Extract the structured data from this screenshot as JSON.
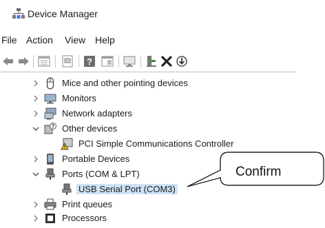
{
  "window": {
    "title": "Device Manager"
  },
  "menu": [
    "File",
    "Action",
    "View",
    "Help"
  ],
  "toolbar": {
    "buttons": [
      "back-icon",
      "forward-icon",
      "properties-list-icon",
      "properties-icon",
      "help-icon",
      "action-view-icon",
      "monitor-icon",
      "update-driver-icon",
      "uninstall-icon",
      "scan-hardware-icon"
    ]
  },
  "tree": {
    "items": [
      {
        "label": "Mice and other pointing devices",
        "state": "collapsed",
        "icon": "mouse-icon"
      },
      {
        "label": "Monitors",
        "state": "collapsed",
        "icon": "monitor-icon"
      },
      {
        "label": "Network adapters",
        "state": "collapsed",
        "icon": "network-adapter-icon"
      },
      {
        "label": "Other devices",
        "state": "expanded",
        "icon": "unknown-device-icon"
      },
      {
        "label": "PCI Simple Communications Controller",
        "state": "child",
        "icon": "warning-device-icon"
      },
      {
        "label": "Portable Devices",
        "state": "collapsed",
        "icon": "portable-device-icon"
      },
      {
        "label": "Ports (COM & LPT)",
        "state": "expanded",
        "icon": "port-icon"
      },
      {
        "label": "USB Serial Port (COM3)",
        "state": "child-selected",
        "icon": "port-icon"
      },
      {
        "label": "Print queues",
        "state": "collapsed",
        "icon": "printer-icon"
      },
      {
        "label": "Processors",
        "state": "collapsed",
        "icon": "processor-icon"
      }
    ]
  },
  "annotation": {
    "text": "Confirm"
  },
  "colors": {
    "selection": "#cfe3f7",
    "accent": "#2a6ebd"
  }
}
